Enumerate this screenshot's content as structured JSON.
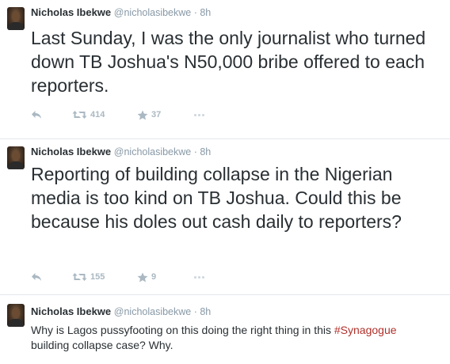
{
  "tweets": [
    {
      "fullname": "Nicholas Ibekwe",
      "meta": "@nicholasibekwe · 8h",
      "text": "Last Sunday, I was the only journalist who turned down TB Joshua's N50,000 bribe offered to each reporters.",
      "retweets": "414",
      "favorites": "37"
    },
    {
      "fullname": "Nicholas Ibekwe",
      "meta": "@nicholasibekwe · 8h",
      "text": "Reporting of building collapse in the Nigerian media is too kind on TB Joshua. Could this be because his doles out cash daily to reporters?",
      "retweets": "155",
      "favorites": "9"
    },
    {
      "fullname": "Nicholas Ibekwe",
      "meta": "@nicholasibekwe · 8h",
      "text_before": "Why is Lagos pussyfooting on this doing the right thing in this ",
      "hashtag": "#Synagogue",
      "text_after": " building collapse case? Why."
    }
  ],
  "icons": {
    "reply": "reply-icon",
    "retweet": "retweet-icon",
    "favorite": "star-icon",
    "more": "more-dots-icon"
  },
  "colors": {
    "text": "#292f33",
    "meta": "#8899a6",
    "action": "#aab8c2",
    "hashtag": "#b0302a",
    "divider": "#e1e8ed"
  }
}
